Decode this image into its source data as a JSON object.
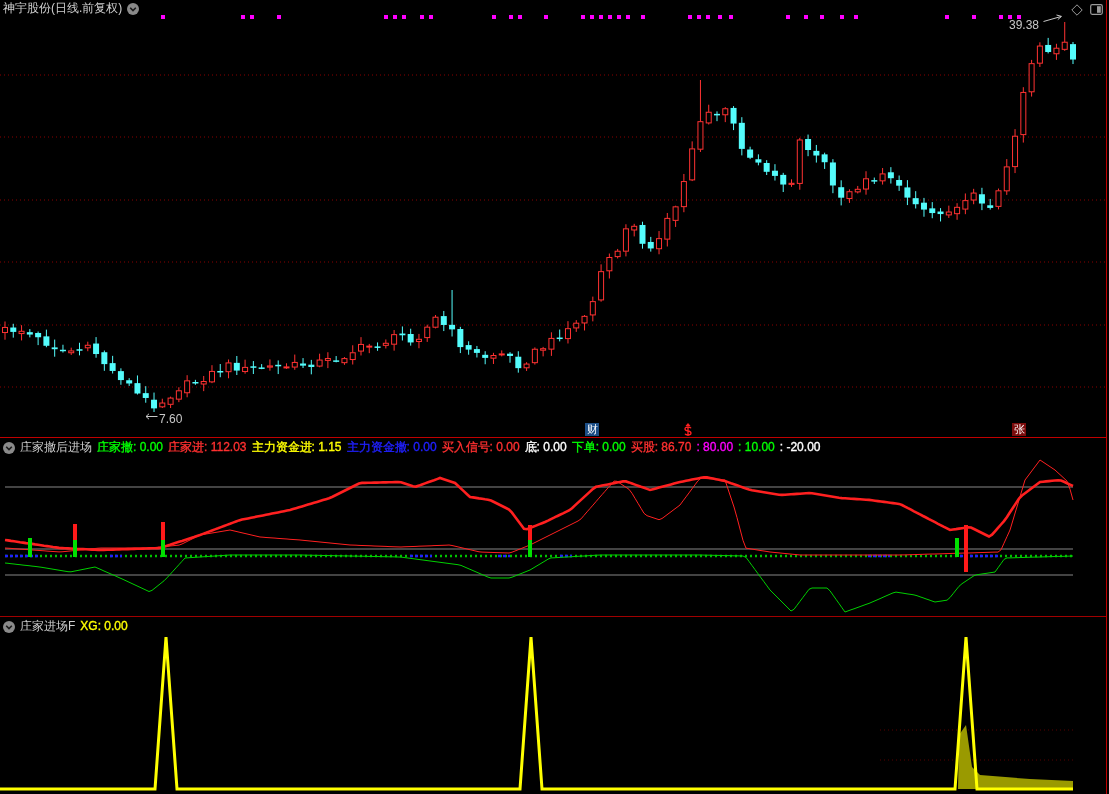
{
  "main_panel": {
    "title": "神宇股份(日线.前复权)",
    "high_label": "39.38",
    "low_label": "7.60",
    "event_markers": [
      {
        "kind": "badge",
        "text": "财",
        "color": "#1c4e86"
      },
      {
        "kind": "dollar",
        "color": "#ff2020"
      },
      {
        "kind": "badge",
        "text": "张",
        "color": "#7c0c0c"
      }
    ]
  },
  "indicator_panel": {
    "title": "庄家撤后进场",
    "readouts": [
      {
        "text": "庄家撤: 0.00",
        "color": "#00ff00"
      },
      {
        "text": "庄家进: 112.03",
        "color": "#ff3030"
      },
      {
        "text": "主力资金进: 1.15",
        "color": "#ffff00"
      },
      {
        "text": "主力资金撤: 0.00",
        "color": "#2020ff"
      },
      {
        "text": "买入信号: 0.00",
        "color": "#ff3030"
      },
      {
        "text": "底: 0.00",
        "color": "#ffffff"
      },
      {
        "text": "下单: 0.00",
        "color": "#00ff00"
      },
      {
        "text": "买股: 86.70",
        "color": "#ff3030"
      },
      {
        "text": ": 80.00",
        "color": "#ff00ff"
      },
      {
        "text": ": 10.00",
        "color": "#00ff00"
      },
      {
        "text": ": -20.00",
        "color": "#ffffff"
      }
    ]
  },
  "signal_panel": {
    "title": "庄家进场F",
    "readouts": [
      {
        "text": "XG: 0.00",
        "color": "#ffff00"
      }
    ]
  }
}
